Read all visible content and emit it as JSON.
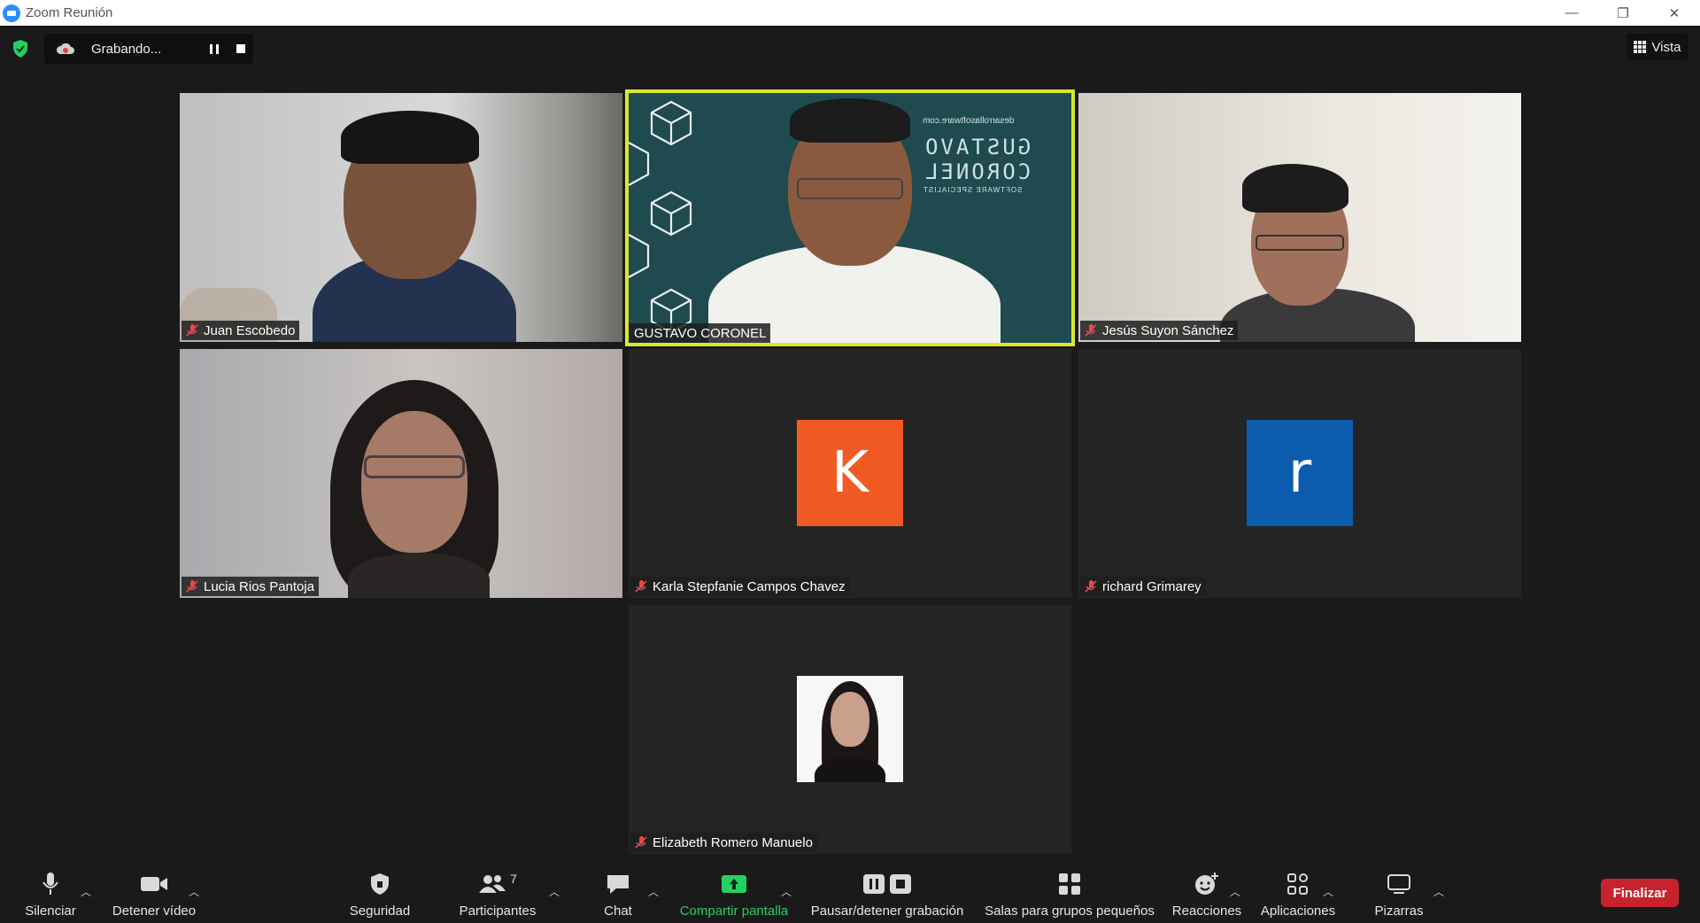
{
  "window": {
    "title": "Zoom Reunión",
    "controls": [
      "—",
      "❐",
      "✕"
    ]
  },
  "recording": {
    "status": "Grabando..."
  },
  "view": {
    "label": "Vista"
  },
  "participants": [
    {
      "name": "Juan Escobedo",
      "muted": true
    },
    {
      "name": "GUSTAVO CORONEL",
      "muted": false,
      "active_speaker": true
    },
    {
      "name": "Jesús Suyon Sánchez",
      "muted": true
    },
    {
      "name": "Lucia Rios Pantoja",
      "muted": true
    },
    {
      "name": "Karla Stepfanie Campos Chavez",
      "muted": true,
      "avatar_letter": "K",
      "avatar_color": "#f15a22"
    },
    {
      "name": "richard Grimarey",
      "muted": true,
      "avatar_letter": "r",
      "avatar_color": "#0b5cad"
    },
    {
      "name": "Elizabeth Romero Manuelo",
      "muted": true
    }
  ],
  "background_text": {
    "domain": "desarrollasoftware.com",
    "first": "GUSTAVO",
    "last": "CORONEL",
    "tagline": "SOFTWARE SPECIALIST"
  },
  "toolbar": {
    "mute": "Silenciar",
    "stop_video": "Detener vídeo",
    "security": "Seguridad",
    "participants": "Participantes",
    "participants_count": "7",
    "chat": "Chat",
    "share_screen": "Compartir pantalla",
    "pause_recording": "Pausar/detener grabación",
    "breakout": "Salas para grupos pequeños",
    "reactions": "Reacciones",
    "apps": "Aplicaciones",
    "whiteboards": "Pizarras",
    "end": "Finalizar"
  },
  "colors": {
    "accent_green": "#23d160",
    "active_border": "#d9e82c",
    "end_red": "#c8232c"
  }
}
